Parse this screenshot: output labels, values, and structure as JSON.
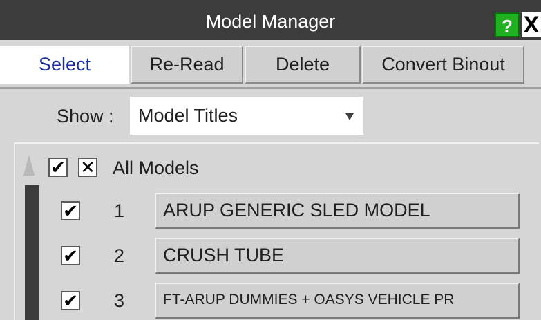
{
  "window": {
    "title": "Model Manager",
    "help_label": "?",
    "close_label": "X"
  },
  "tabs": [
    {
      "label": "Select",
      "active": true
    },
    {
      "label": "Re-Read",
      "active": false
    },
    {
      "label": "Delete",
      "active": false
    },
    {
      "label": "Convert Binout",
      "active": false
    }
  ],
  "show": {
    "label": "Show :",
    "selected": "Model Titles"
  },
  "list": {
    "all_label": "All Models",
    "check_glyph": "✔",
    "cross_glyph": "✕",
    "models": [
      {
        "number": "1",
        "title": "ARUP GENERIC SLED MODEL",
        "checked": true
      },
      {
        "number": "2",
        "title": "CRUSH TUBE",
        "checked": true
      },
      {
        "number": "3",
        "title": "FT-ARUP DUMMIES + OASYS VEHICLE PR",
        "checked": true
      }
    ]
  },
  "colors": {
    "titlebar": "#3c3c3c",
    "active_tab_text": "#1a2fa0",
    "help_button": "#20b020"
  }
}
